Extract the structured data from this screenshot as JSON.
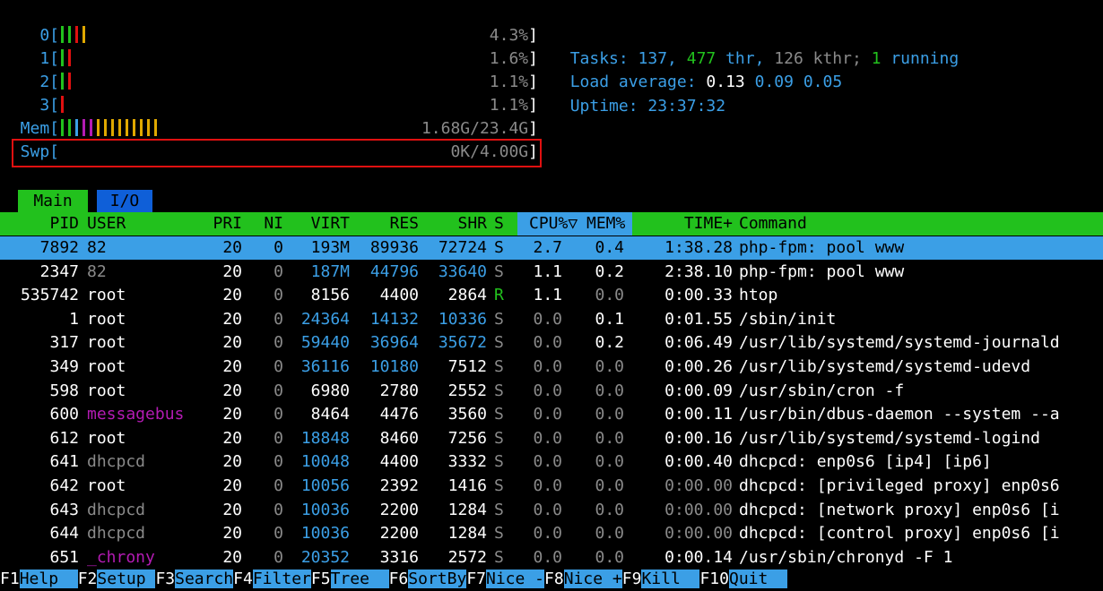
{
  "meters": {
    "cpus": [
      {
        "label": "0[",
        "value": "4.3%]",
        "bars": [
          "#22c11d",
          "#22c11d",
          "#e01010",
          "#e0a800"
        ]
      },
      {
        "label": "1[",
        "value": "1.6%]",
        "bars": [
          "#22c11d",
          "#e01010"
        ]
      },
      {
        "label": "2[",
        "value": "1.1%]",
        "bars": [
          "#22c11d",
          "#e01010"
        ]
      },
      {
        "label": "3[",
        "value": "1.1%]",
        "bars": [
          "#e01010"
        ]
      }
    ],
    "mem": {
      "label": "Mem[",
      "value": "1.68G/23.4G]",
      "bars": [
        "#22c11d",
        "#22c11d",
        "#3b9fe6",
        "#b31bb3",
        "#b31bb3",
        "#e0a800",
        "#e0a800",
        "#e0a800",
        "#e0a800",
        "#e0a800",
        "#e0a800",
        "#e0a800",
        "#e0a800",
        "#e0a800"
      ]
    },
    "swp": {
      "label": "Swp[",
      "value": "0K/4.00G]"
    }
  },
  "info": {
    "tasks_label": "Tasks: ",
    "tasks_count": "137, ",
    "thr_count": "477",
    "thr_label": " thr, ",
    "kthr": "126 kthr; ",
    "running_count": "1",
    "running_label": " running",
    "load_label": "Load average: ",
    "load_1": "0.13",
    "load_5": "0.09",
    "load_15": "0.05",
    "uptime_label": "Uptime: ",
    "uptime_value": "23:37:32"
  },
  "tabs": {
    "main": "Main",
    "io": "I/O"
  },
  "columns": {
    "pid": "PID",
    "user": "USER",
    "pri": "PRI",
    "ni": "NI",
    "virt": "VIRT",
    "res": "RES",
    "shr": "SHR",
    "s": "S",
    "cpu": "CPU%▽",
    "mem": "MEM%",
    "time": "TIME+",
    "command": "Command"
  },
  "processes": [
    {
      "pid": "7892",
      "user": "82",
      "pri": "20",
      "ni": "0",
      "virt": "193M",
      "res": "89936",
      "shr": "72724",
      "s": "S",
      "cpu": "2.7",
      "mem": "0.4",
      "time": "1:38.28",
      "command": "php-fpm: pool www"
    },
    {
      "pid": "2347",
      "user": "82",
      "pri": "20",
      "ni": "0",
      "virt": "187M",
      "res": "44796",
      "shr": "33640",
      "s": "S",
      "cpu": "1.1",
      "mem": "0.2",
      "time": "2:38.10",
      "command": "php-fpm: pool www"
    },
    {
      "pid": "535742",
      "user": "root",
      "pri": "20",
      "ni": "0",
      "virt": "8156",
      "res": "4400",
      "shr": "2864",
      "s": "R",
      "cpu": "1.1",
      "mem": "0.0",
      "time": "0:00.33",
      "command": "htop"
    },
    {
      "pid": "1",
      "user": "root",
      "pri": "20",
      "ni": "0",
      "virt": "24364",
      "res": "14132",
      "shr": "10336",
      "s": "S",
      "cpu": "0.0",
      "mem": "0.1",
      "time": "0:01.55",
      "command": "/sbin/init"
    },
    {
      "pid": "317",
      "user": "root",
      "pri": "20",
      "ni": "0",
      "virt": "59440",
      "res": "36964",
      "shr": "35672",
      "s": "S",
      "cpu": "0.0",
      "mem": "0.2",
      "time": "0:06.49",
      "command": "/usr/lib/systemd/systemd-journald"
    },
    {
      "pid": "349",
      "user": "root",
      "pri": "20",
      "ni": "0",
      "virt": "36116",
      "res": "10180",
      "shr": "7512",
      "s": "S",
      "cpu": "0.0",
      "mem": "0.0",
      "time": "0:00.26",
      "command": "/usr/lib/systemd/systemd-udevd"
    },
    {
      "pid": "598",
      "user": "root",
      "pri": "20",
      "ni": "0",
      "virt": "6980",
      "res": "2780",
      "shr": "2552",
      "s": "S",
      "cpu": "0.0",
      "mem": "0.0",
      "time": "0:00.09",
      "command": "/usr/sbin/cron -f"
    },
    {
      "pid": "600",
      "user": "messagebus",
      "pri": "20",
      "ni": "0",
      "virt": "8464",
      "res": "4476",
      "shr": "3560",
      "s": "S",
      "cpu": "0.0",
      "mem": "0.0",
      "time": "0:00.11",
      "command": "/usr/bin/dbus-daemon --system --a"
    },
    {
      "pid": "612",
      "user": "root",
      "pri": "20",
      "ni": "0",
      "virt": "18848",
      "res": "8460",
      "shr": "7256",
      "s": "S",
      "cpu": "0.0",
      "mem": "0.0",
      "time": "0:00.16",
      "command": "/usr/lib/systemd/systemd-logind"
    },
    {
      "pid": "641",
      "user": "dhcpcd",
      "pri": "20",
      "ni": "0",
      "virt": "10048",
      "res": "4400",
      "shr": "3332",
      "s": "S",
      "cpu": "0.0",
      "mem": "0.0",
      "time": "0:00.40",
      "command": "dhcpcd: enp0s6 [ip4] [ip6]"
    },
    {
      "pid": "642",
      "user": "root",
      "pri": "20",
      "ni": "0",
      "virt": "10056",
      "res": "2392",
      "shr": "1416",
      "s": "S",
      "cpu": "0.0",
      "mem": "0.0",
      "time": "0:00.00",
      "command": "dhcpcd: [privileged proxy] enp0s6"
    },
    {
      "pid": "643",
      "user": "dhcpcd",
      "pri": "20",
      "ni": "0",
      "virt": "10036",
      "res": "2200",
      "shr": "1284",
      "s": "S",
      "cpu": "0.0",
      "mem": "0.0",
      "time": "0:00.00",
      "command": "dhcpcd: [network proxy] enp0s6 [i"
    },
    {
      "pid": "644",
      "user": "dhcpcd",
      "pri": "20",
      "ni": "0",
      "virt": "10036",
      "res": "2200",
      "shr": "1284",
      "s": "S",
      "cpu": "0.0",
      "mem": "0.0",
      "time": "0:00.00",
      "command": "dhcpcd: [control proxy] enp0s6 [i"
    },
    {
      "pid": "651",
      "user": "_chrony",
      "pri": "20",
      "ni": "0",
      "virt": "20352",
      "res": "3316",
      "shr": "2572",
      "s": "S",
      "cpu": "0.0",
      "mem": "0.0",
      "time": "0:00.14",
      "command": "/usr/sbin/chronyd -F 1"
    }
  ],
  "function_keys": [
    {
      "key": "F1",
      "label": "Help  "
    },
    {
      "key": "F2",
      "label": "Setup "
    },
    {
      "key": "F3",
      "label": "Search"
    },
    {
      "key": "F4",
      "label": "Filter"
    },
    {
      "key": "F5",
      "label": "Tree  "
    },
    {
      "key": "F6",
      "label": "SortBy"
    },
    {
      "key": "F7",
      "label": "Nice -"
    },
    {
      "key": "F8",
      "label": "Nice +"
    },
    {
      "key": "F9",
      "label": "Kill  "
    },
    {
      "key": "F10",
      "label": "Quit  "
    }
  ],
  "colors": {
    "green": "#22c11d",
    "blue": "#3b9fe6",
    "red": "#e01010",
    "grey": "#8a8a8a",
    "purple": "#b31bb3",
    "yellow": "#e0a800"
  }
}
